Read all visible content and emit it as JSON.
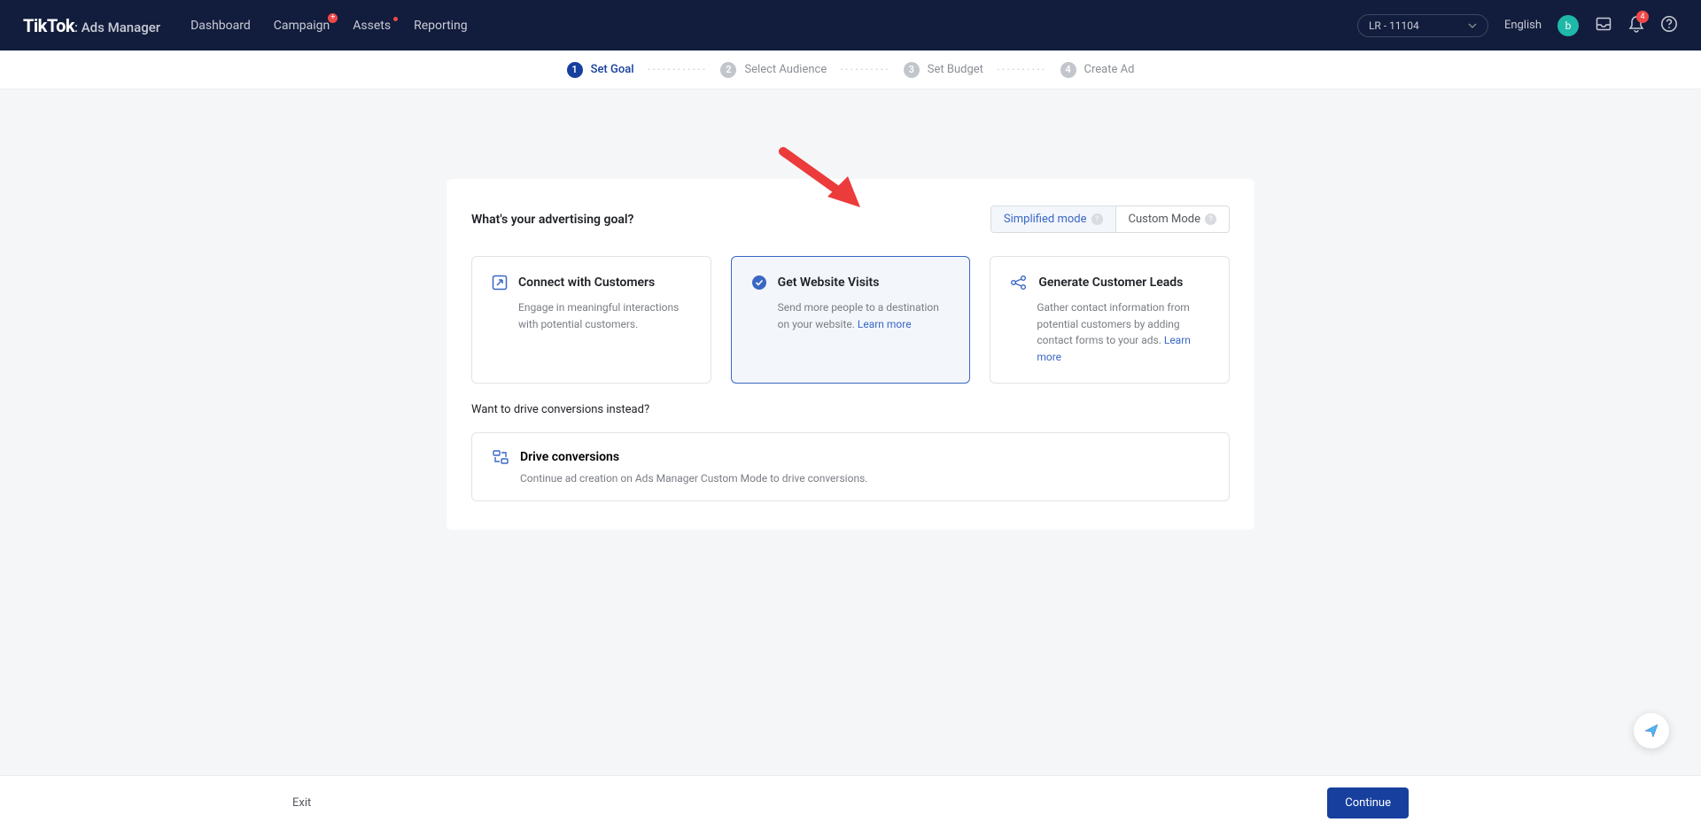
{
  "topbar": {
    "brand": "TikTok",
    "brand_sub": ": Ads Manager",
    "nav": [
      "Dashboard",
      "Campaign",
      "Assets",
      "Reporting"
    ],
    "account_label": "LR - 11104",
    "language": "English",
    "avatar_initial": "b",
    "notification_count": "4"
  },
  "steps": [
    {
      "num": "1",
      "label": "Set Goal"
    },
    {
      "num": "2",
      "label": "Select Audience"
    },
    {
      "num": "3",
      "label": "Set Budget"
    },
    {
      "num": "4",
      "label": "Create Ad"
    }
  ],
  "card": {
    "title": "What's your advertising goal?",
    "mode_simplified": "Simplified mode",
    "mode_custom": "Custom Mode",
    "goals": [
      {
        "title": "Connect with Customers",
        "desc": "Engage in meaningful interactions with potential customers."
      },
      {
        "title": "Get Website Visits",
        "desc": "Send more people to a destination on your website. ",
        "learn_more": "Learn more"
      },
      {
        "title": "Generate Customer Leads",
        "desc": "Gather contact information from potential customers by adding contact forms to your ads. ",
        "learn_more": "Learn more"
      }
    ],
    "sub_heading": "Want to drive conversions instead?",
    "drive": {
      "title": "Drive conversions",
      "desc": "Continue ad creation on Ads Manager Custom Mode to drive conversions."
    }
  },
  "footer": {
    "exit": "Exit",
    "continue": "Continue"
  }
}
